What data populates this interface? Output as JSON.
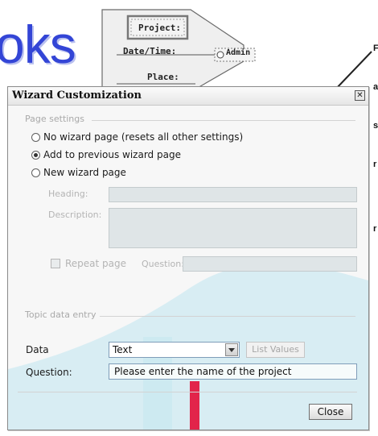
{
  "background": {
    "big_word": "oks",
    "tag": {
      "project": "Project:",
      "datetime": "Date/Time:",
      "place": "Place:",
      "admin": "Admin"
    },
    "callout_lines": [
      "F",
      "a",
      "s",
      "r",
      "",
      "r"
    ]
  },
  "dialog": {
    "title": "Wizard Customization",
    "close_glyph": "✕",
    "page_settings": {
      "label": "Page settings",
      "options": [
        {
          "label": "No wizard page (resets all other settings)",
          "checked": false
        },
        {
          "label": "Add to previous wizard page",
          "checked": true
        },
        {
          "label": "New wizard page",
          "checked": false
        }
      ],
      "heading_label": "Heading:",
      "description_label": "Description:",
      "repeat_label": "Repeat page",
      "question_label": "Question:"
    },
    "topic_data_entry": {
      "label": "Topic data entry",
      "data_label": "Data",
      "data_value": "Text",
      "list_values_label": "List Values",
      "question_label": "Question:",
      "question_value": "Please enter the name of the project"
    },
    "close_button": "Close"
  },
  "colors": {
    "accent_blue": "#3345d6",
    "watermark_teal": "#bfe6ee",
    "watermark_red": "#e4002b"
  }
}
